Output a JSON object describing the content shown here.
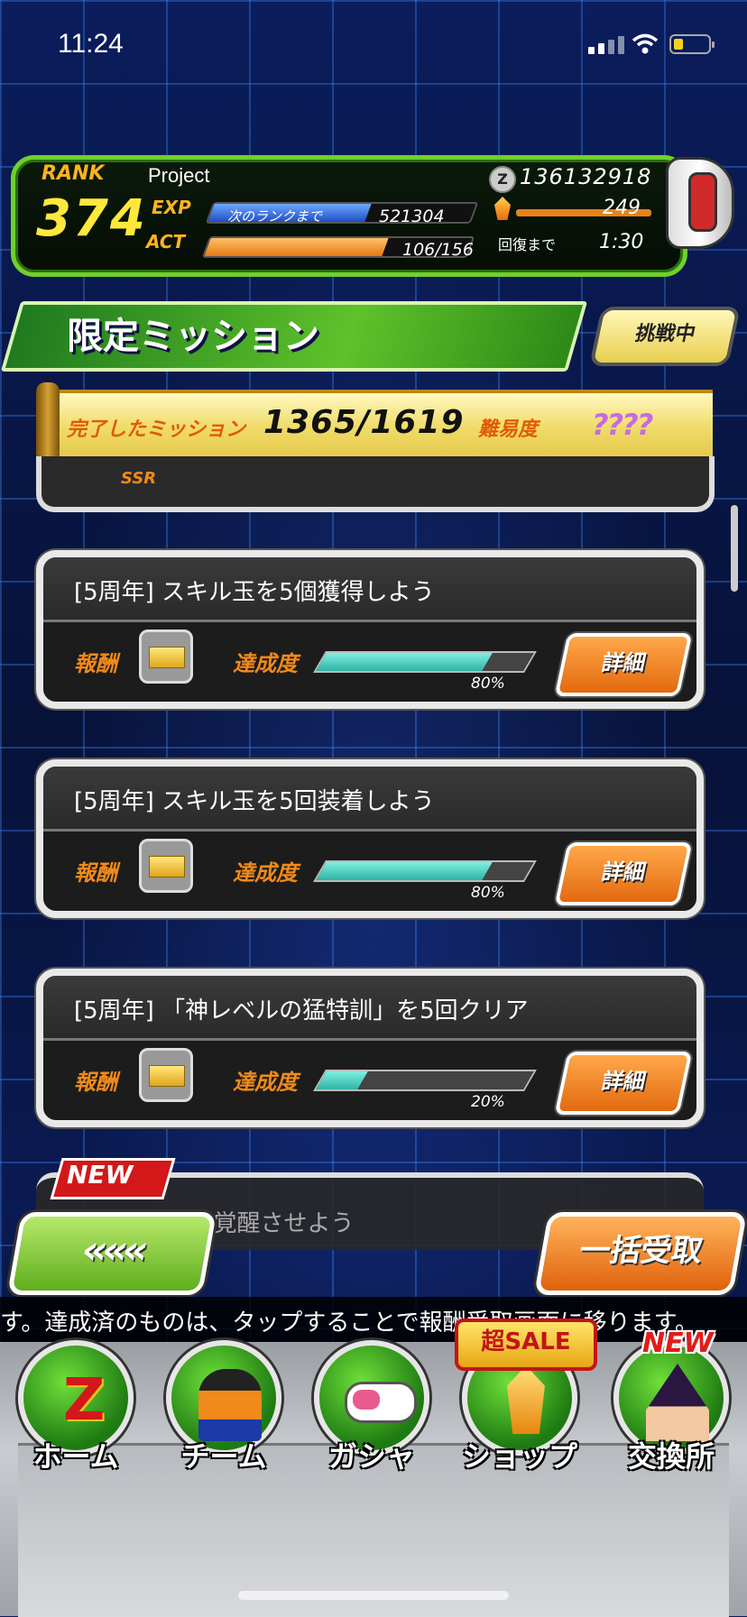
{
  "status_bar": {
    "time": "11:24"
  },
  "rank_panel": {
    "rank_label": "RANK",
    "rank": "374",
    "player_name": "Project",
    "exp_label": "EXP",
    "exp_next_label": "次のランクまで",
    "exp_remaining": "521304",
    "act_label": "ACT",
    "act_value": "106/156",
    "act_fraction": 0.68,
    "exp_fraction": 0.6,
    "zeni_icon": "z-coin-icon",
    "zeni": "136132918",
    "stones": "249",
    "recover_label": "回復まで",
    "recover_time": "1:30"
  },
  "header": {
    "title": "限定ミッション",
    "status": "挑戦中"
  },
  "banner": {
    "completed_label": "完了したミッション",
    "completed_count": "1365/1619",
    "difficulty_label": "難易度",
    "difficulty_value": "????"
  },
  "partial_card": {
    "badge": "SSR"
  },
  "missions": [
    {
      "title": "[5周年] スキル玉を5個獲得しよう",
      "reward_label": "報酬",
      "progress_label": "達成度",
      "progress": 0.8,
      "progress_text": "80%",
      "detail_label": "詳細"
    },
    {
      "title": "[5周年] スキル玉を5回装着しよう",
      "reward_label": "報酬",
      "progress_label": "達成度",
      "progress": 0.8,
      "progress_text": "80%",
      "detail_label": "詳細"
    },
    {
      "title": "[5周年] 「神レベルの猛特訓」を5回クリア",
      "reward_label": "報酬",
      "progress_label": "達成度",
      "progress": 0.2,
      "progress_text": "20%",
      "detail_label": "詳細"
    }
  ],
  "new_card": {
    "badge": "NEW",
    "text": "を2覚醒させよう"
  },
  "actions": {
    "back_label": "«««",
    "bulk_label": "一括受取"
  },
  "ticker": "す。達成済のものは、タップすることで報酬受取画面に移ります。",
  "nav": {
    "items": [
      {
        "label": "ホーム",
        "icon": "dragonball-z-icon"
      },
      {
        "label": "チーム",
        "icon": "team-icon"
      },
      {
        "label": "ガシャ",
        "icon": "capsule-icon"
      },
      {
        "label": "ショップ",
        "icon": "crystal-icon"
      },
      {
        "label": "交換所",
        "icon": "witch-icon"
      }
    ],
    "sale_badge": "超SALE",
    "new_badge": "NEW"
  },
  "colors": {
    "accent_green": "#6fd12a",
    "accent_orange": "#e3690f",
    "progress_teal": "#2fb3a6"
  }
}
